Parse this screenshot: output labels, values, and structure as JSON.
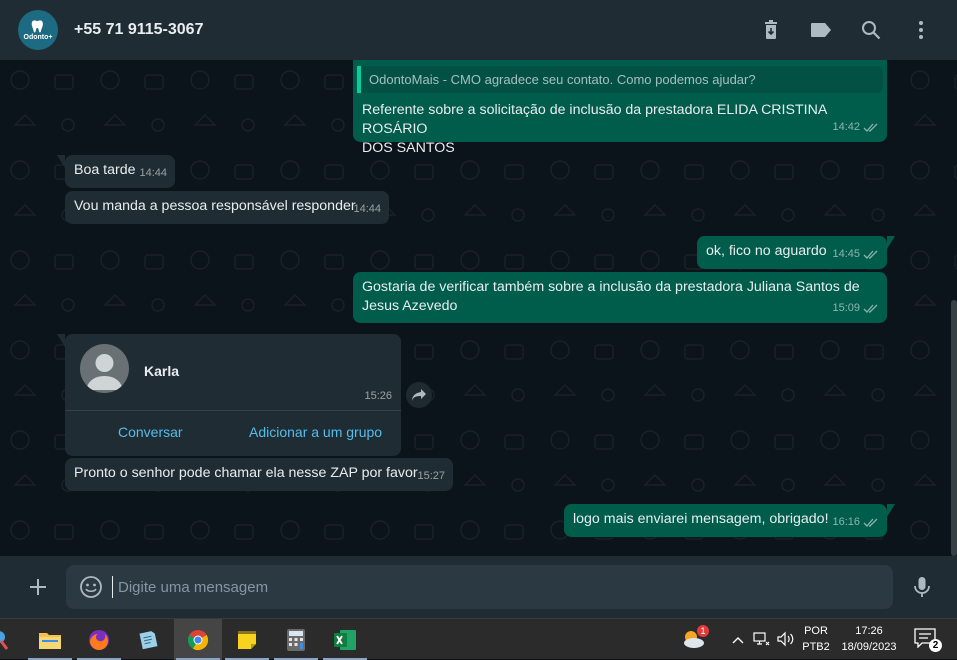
{
  "header": {
    "logo_text": "Odonto+",
    "contact_name": "+55 71 9115-3067",
    "icons": [
      "delete-icon",
      "label-icon",
      "search-icon",
      "menu-icon"
    ]
  },
  "messages": [
    {
      "dir": "out",
      "quote": "OdontoMais - CMO agradece seu contato. Como podemos ajudar?",
      "text_line1": "Referente sobre a solicitação de inclusão da prestadora ELIDA CRISTINA ROSÁRIO",
      "text_line2": "DOS SANTOS",
      "time": "14:42"
    },
    {
      "dir": "in",
      "text": "Boa tarde",
      "time": "14:44"
    },
    {
      "dir": "in",
      "text": "Vou manda a pessoa responsável responder",
      "time": "14:44"
    },
    {
      "dir": "out",
      "text": "ok, fico no aguardo",
      "time": "14:45"
    },
    {
      "dir": "out",
      "text_line1": "Gostaria de verificar também sobre a inclusão da prestadora Juliana Santos de",
      "text_line2": "Jesus Azevedo",
      "time": "15:09"
    },
    {
      "dir": "in",
      "text": "Pronto o senhor pode chamar ela nesse ZAP por favor",
      "time": "15:27"
    },
    {
      "dir": "out",
      "text": "logo mais enviarei mensagem, obrigado!",
      "time": "16:16"
    }
  ],
  "contact_card": {
    "name": "Karla",
    "time": "15:26",
    "action_chat": "Conversar",
    "action_group": "Adicionar a um grupo"
  },
  "composer": {
    "placeholder": "Digite uma mensagem"
  },
  "taskbar": {
    "notification_count": "1",
    "lang_top": "POR",
    "lang_bottom": "PTB2",
    "clock_time": "17:26",
    "clock_date": "18/09/2023",
    "action_center_count": "2"
  },
  "colors": {
    "header_bg": "#202c33",
    "chat_bg": "#0b141a",
    "outgoing": "#005c4b",
    "incoming": "#202c33",
    "link": "#53bdeb",
    "tick_read": "#53bdeb"
  }
}
